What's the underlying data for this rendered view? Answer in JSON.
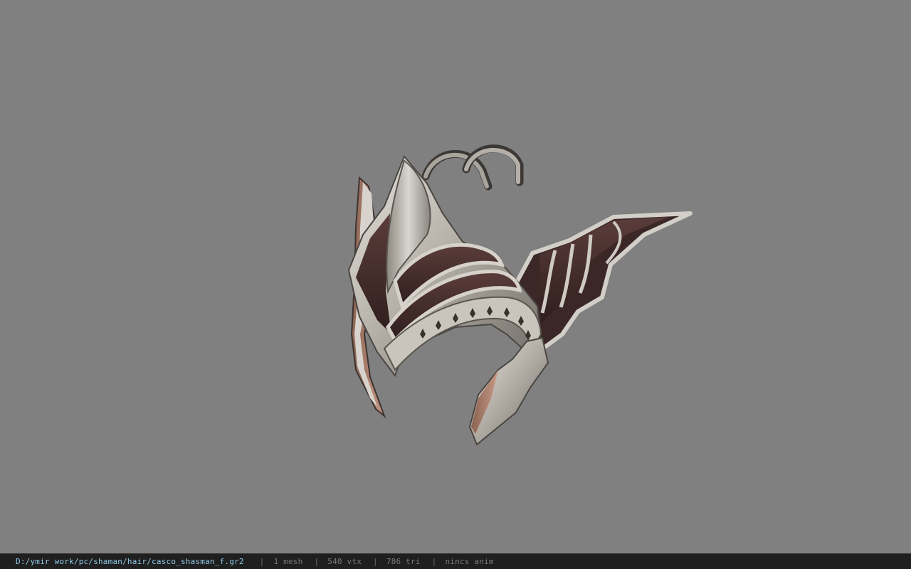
{
  "viewer": {
    "background_color": "#808080",
    "model_icon": "helmet-model"
  },
  "statusbar": {
    "path": "D:/ymir work/pc/shaman/hair/casco_shasman_f.gr2",
    "separator": "|",
    "mesh": "1 mesh",
    "vtx": "540 vtx",
    "tri": "786 tri",
    "anim": "nincs anim",
    "path_color": "#8fc8e8",
    "text_color": "#7a7a7a"
  }
}
